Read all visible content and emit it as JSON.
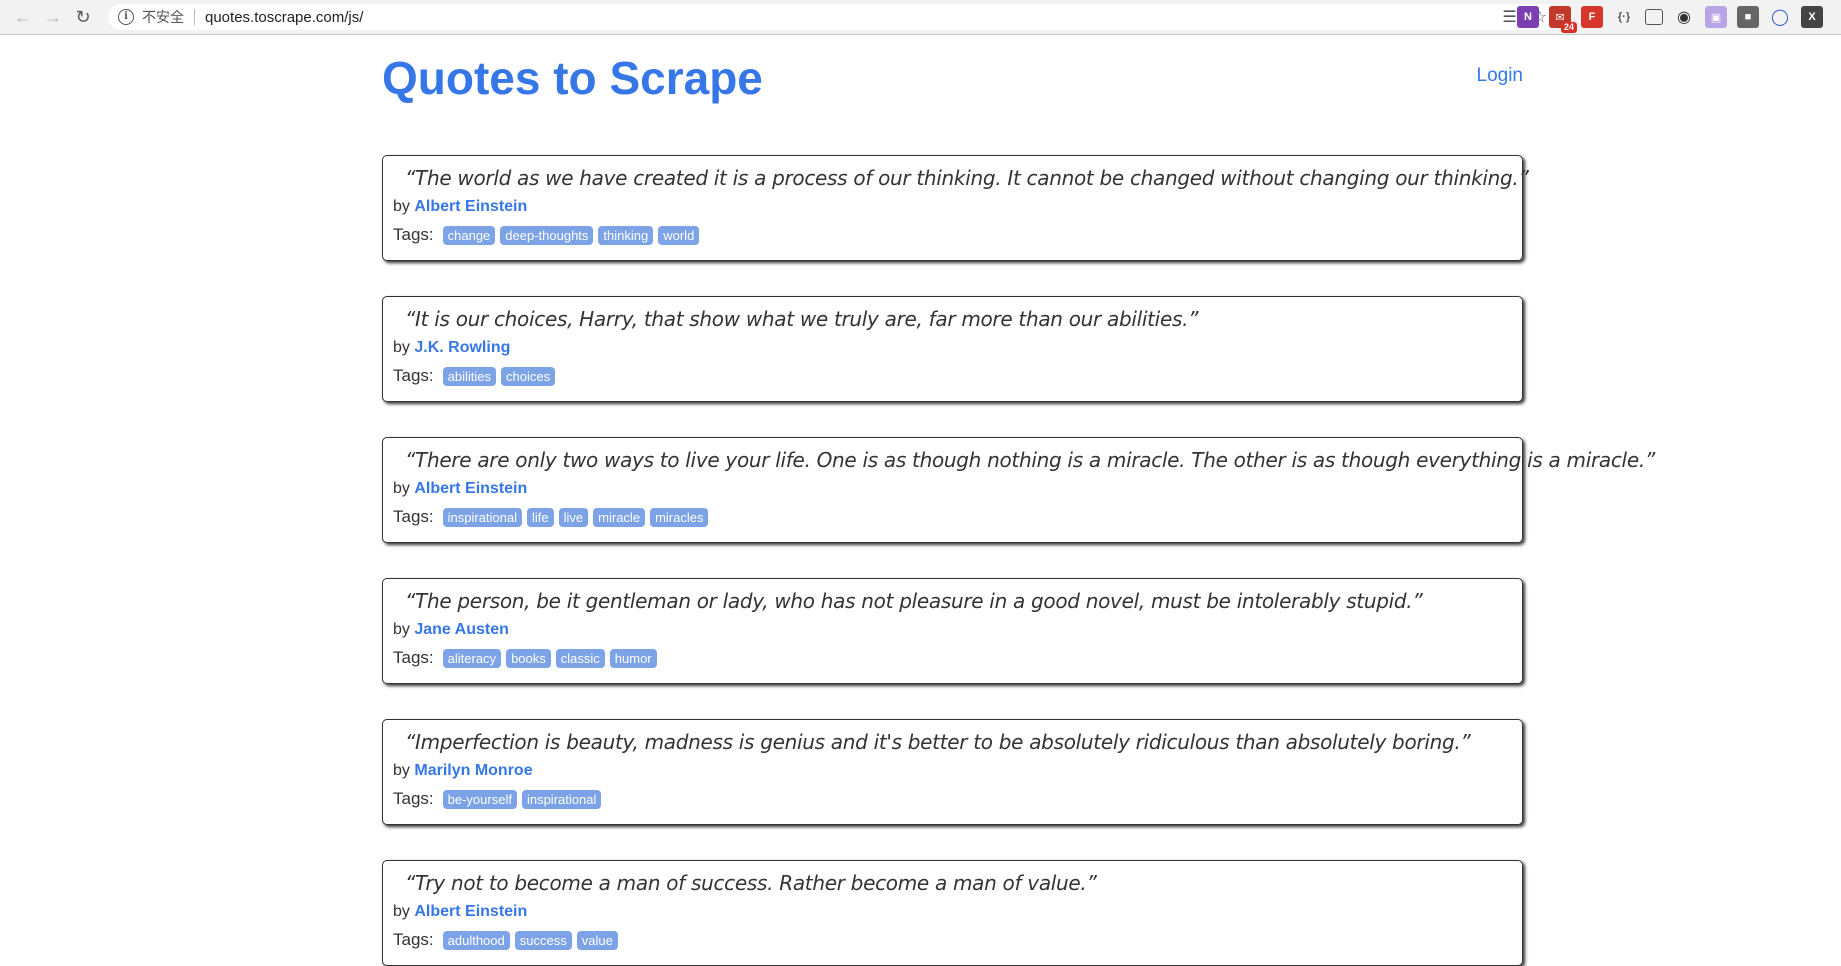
{
  "browser": {
    "security_label": "不安全",
    "url": "quotes.toscrape.com/js/"
  },
  "header": {
    "title": "Quotes to Scrape",
    "login": "Login"
  },
  "labels": {
    "by": "by",
    "tags": "Tags:"
  },
  "quotes": [
    {
      "text": "“The world as we have created it is a process of our thinking. It cannot be changed without changing our thinking.”",
      "author": "Albert Einstein",
      "tags": [
        "change",
        "deep-thoughts",
        "thinking",
        "world"
      ]
    },
    {
      "text": "“It is our choices, Harry, that show what we truly are, far more than our abilities.”",
      "author": "J.K. Rowling",
      "tags": [
        "abilities",
        "choices"
      ]
    },
    {
      "text": "“There are only two ways to live your life. One is as though nothing is a miracle. The other is as though everything is a miracle.”",
      "author": "Albert Einstein",
      "tags": [
        "inspirational",
        "life",
        "live",
        "miracle",
        "miracles"
      ]
    },
    {
      "text": "“The person, be it gentleman or lady, who has not pleasure in a good novel, must be intolerably stupid.”",
      "author": "Jane Austen",
      "tags": [
        "aliteracy",
        "books",
        "classic",
        "humor"
      ]
    },
    {
      "text": "“Imperfection is beauty, madness is genius and it's better to be absolutely ridiculous than absolutely boring.”",
      "author": "Marilyn Monroe",
      "tags": [
        "be-yourself",
        "inspirational"
      ]
    },
    {
      "text": "“Try not to become a man of success. Rather become a man of value.”",
      "author": "Albert Einstein",
      "tags": [
        "adulthood",
        "success",
        "value"
      ]
    }
  ],
  "colors": {
    "link": "#3677e8",
    "tag_bg": "#7ca3e6"
  }
}
